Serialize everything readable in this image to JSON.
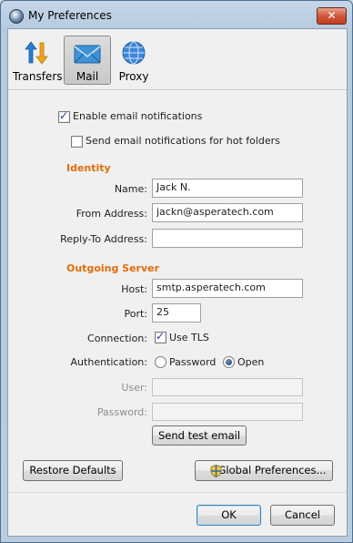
{
  "window": {
    "title": "My Preferences",
    "close_glyph": "✕"
  },
  "toolbar": {
    "items": [
      {
        "label": "Transfers",
        "icon": "transfers-icon",
        "selected": false
      },
      {
        "label": "Mail",
        "icon": "mail-icon",
        "selected": true
      },
      {
        "label": "Proxy",
        "icon": "proxy-icon",
        "selected": false
      }
    ]
  },
  "mail": {
    "enable_notifications": {
      "label": "Enable email notifications",
      "checked": true
    },
    "hot_folders": {
      "label": "Send email notifications for hot folders",
      "checked": false
    },
    "identity": {
      "heading": "Identity",
      "name_label": "Name:",
      "name_value": "Jack N.",
      "from_label": "From Address:",
      "from_value": "jackn@asperatech.com",
      "reply_label": "Reply-To Address:",
      "reply_value": ""
    },
    "server": {
      "heading": "Outgoing Server",
      "host_label": "Host:",
      "host_value": "smtp.asperatech.com",
      "port_label": "Port:",
      "port_value": "25",
      "connection_label": "Connection:",
      "use_tls_label": "Use TLS",
      "use_tls_checked": true,
      "auth_label": "Authentication:",
      "auth_options": [
        {
          "label": "Password",
          "selected": false
        },
        {
          "label": "Open",
          "selected": true
        }
      ],
      "user_label": "User:",
      "user_value": "",
      "password_label": "Password:",
      "password_value": "",
      "test_button": "Send test email"
    }
  },
  "buttons": {
    "restore": "Restore Defaults",
    "global": "Global Preferences...",
    "ok": "OK",
    "cancel": "Cancel"
  },
  "colors": {
    "section_heading": "#e46c0a",
    "title_bar": "#c6d6e8",
    "close_button": "#c9462a"
  }
}
